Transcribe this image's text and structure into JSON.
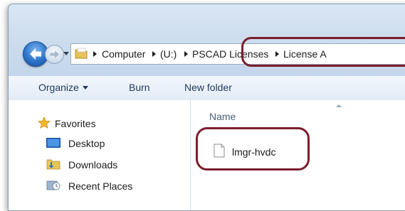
{
  "address_bar": {
    "crumbs": [
      "Computer",
      "(U:)",
      "PSCAD Licenses",
      "License A"
    ]
  },
  "toolbar": {
    "organize_label": "Organize",
    "burn_label": "Burn",
    "new_folder_label": "New folder"
  },
  "nav_pane": {
    "items": [
      {
        "label": "Favorites",
        "icon": "star-icon"
      },
      {
        "label": "Desktop",
        "icon": "desktop-icon"
      },
      {
        "label": "Downloads",
        "icon": "downloads-folder-icon"
      },
      {
        "label": "Recent Places",
        "icon": "recent-places-icon"
      }
    ]
  },
  "file_list": {
    "column_header": "Name",
    "files": [
      {
        "name": "lmgr-hvdc",
        "icon": "file-icon"
      }
    ]
  },
  "colors": {
    "highlight_oval": "#7b1e2c",
    "toolbar_text": "#1e395b",
    "back_button": "#2d73c9"
  }
}
